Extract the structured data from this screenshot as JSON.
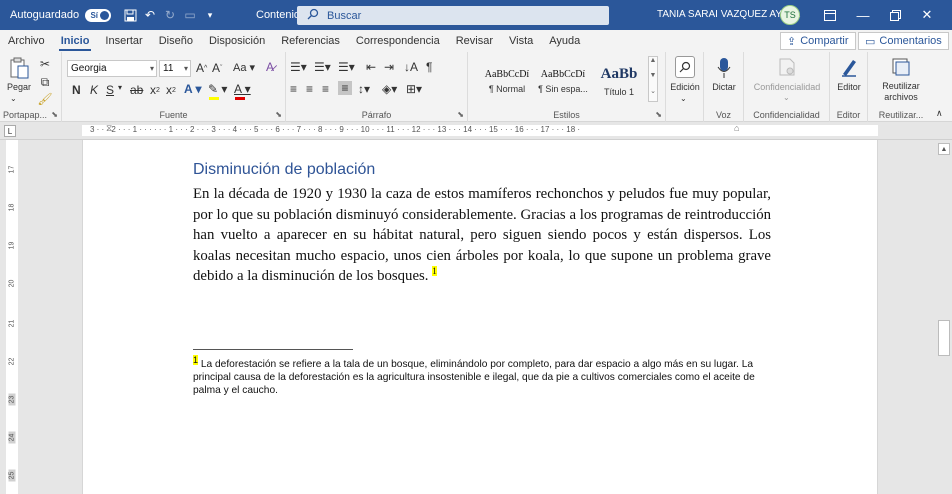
{
  "titlebar": {
    "autosave_label": "Autoguardado",
    "autosave_state": "Sí",
    "doc_status": "Contenido - Guardando...",
    "search_label": "Buscar",
    "user_name": "TANIA SARAI VAZQUEZ AYALA",
    "user_initials": "TS"
  },
  "tabs": [
    "Archivo",
    "Inicio",
    "Insertar",
    "Diseño",
    "Disposición",
    "Referencias",
    "Correspondencia",
    "Revisar",
    "Vista",
    "Ayuda"
  ],
  "actions": {
    "share": "Compartir",
    "comments": "Comentarios"
  },
  "ribbon": {
    "clipboard": {
      "label": "Portapap...",
      "paste": "Pegar"
    },
    "font": {
      "label": "Fuente",
      "family": "Georgia",
      "size": "11",
      "bold": "N",
      "italic": "K",
      "underline": "S"
    },
    "paragraph": {
      "label": "Párrafo"
    },
    "styles": {
      "label": "Estilos",
      "items": [
        {
          "preview": "AaBbCcDí",
          "name": "¶ Normal"
        },
        {
          "preview": "AaBbCcDí",
          "name": "¶ Sin espa..."
        },
        {
          "preview": "AaBb",
          "name": "Título 1"
        }
      ]
    },
    "editing": {
      "label": "Edición"
    },
    "voice": {
      "label": "Voz",
      "dictate": "Dictar"
    },
    "sensitivity": {
      "label": "Confidencialidad",
      "button": "Confidencialidad"
    },
    "editor": {
      "label": "Editor",
      "button": "Editor"
    },
    "reuse": {
      "label": "Reutilizar...",
      "button_line1": "Reutilizar",
      "button_line2": "archivos"
    }
  },
  "ruler": {
    "horizontal": "3 · · · 2 · · · 1 · · · · · · 1 · · · 2 · · · 3 · · · 4 · · · 5 · · · 6 · · · 7 · · · 8 · · · 9 · · · 10 · · · 11 · · · 12 · · · 13 · · · 14 · · · 15 · · · 16 · · · 17 · · · 18 ·",
    "vertical": [
      "17",
      "18",
      "19",
      "20",
      "21",
      "22",
      "23",
      "24",
      "25"
    ]
  },
  "document": {
    "heading": "Disminución de población",
    "paragraph": "En la década de 1920 y 1930 la caza de estos mamíferos rechonchos y peludos fue muy popular, por lo que su población disminuyó considerablemente. Gracias a los programas de reintroducción han vuelto a aparecer en su hábitat natural, pero siguen siendo pocos y están dispersos. Los koalas necesitan mucho espacio, unos cien árboles por koala, lo que supone un problema grave debido a la disminución de los bosques.",
    "footnote_ref": "1",
    "footnote_mark": "1",
    "footnote_text": " La deforestación se refiere a la tala de un bosque, eliminándolo por completo, para dar espacio a algo más en su lugar. La principal causa de la deforestación es la agricultura insostenible e ilegal, que da pie a cultivos comerciales como el aceite de palma y el caucho."
  },
  "colors": {
    "brand": "#2b579a",
    "heading": "#2f5496",
    "highlight": "#ffff00"
  }
}
